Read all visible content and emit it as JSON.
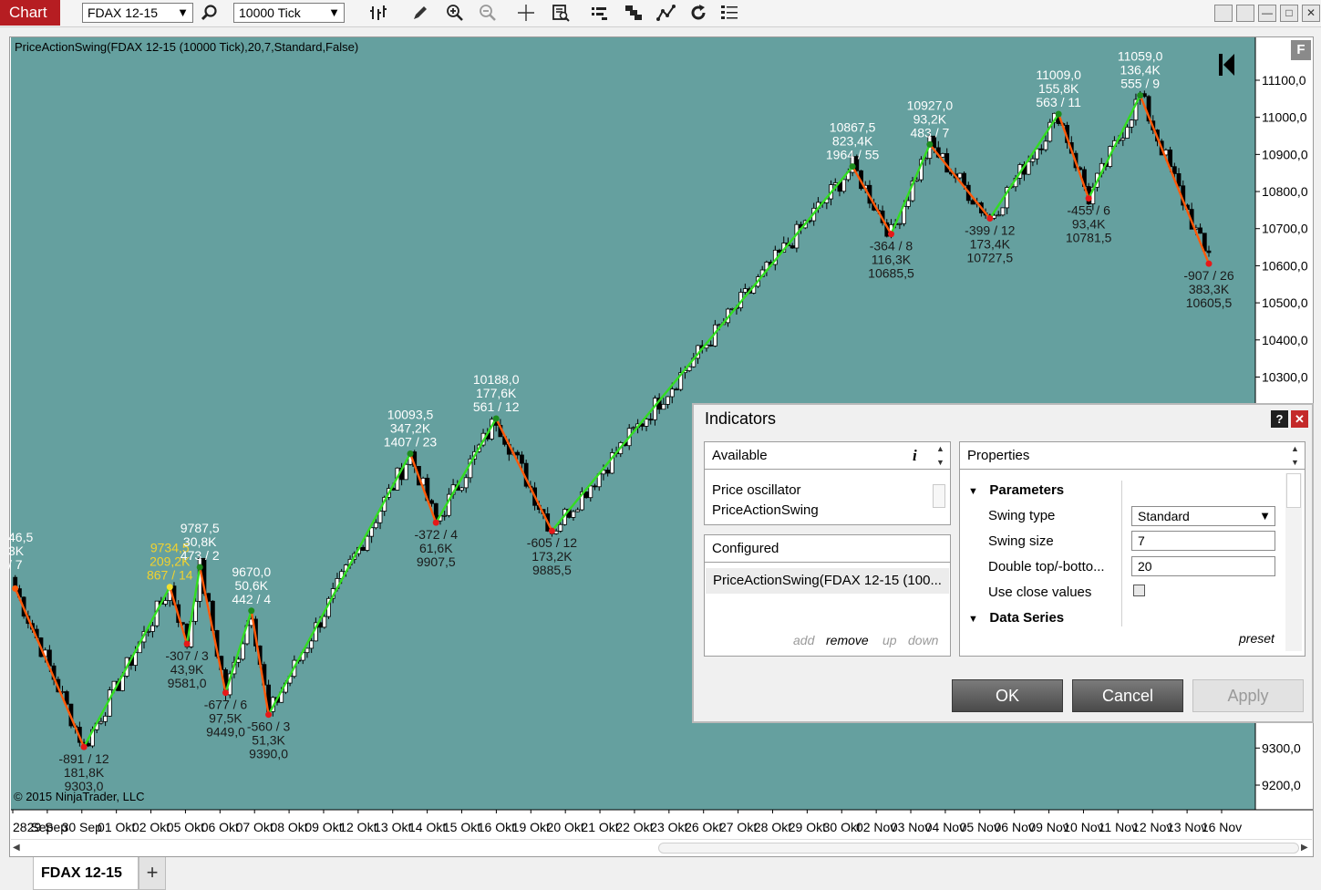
{
  "toolbar": {
    "chart_tab": "Chart",
    "instrument": "FDAX 12-15",
    "interval": "10000 Tick",
    "icons": [
      "search-icon",
      "bar-type-icon",
      "pencil-icon",
      "zoom-in-icon",
      "zoom-out-icon",
      "crosshair-icon",
      "data-box-icon",
      "strategy-icon",
      "chart-trader-icon",
      "indicator-icon",
      "refresh-icon",
      "properties-icon"
    ],
    "window_icons": [
      "minimize-icon",
      "restore-icon",
      "maximize-icon",
      "close-icon"
    ]
  },
  "chart": {
    "title": "PriceActionSwing(FDAX 12-15 (10000 Tick),20,7,Standard,False)",
    "copyright": "© 2015 NinjaTrader, LLC",
    "right_corner_button": "F",
    "colors": {
      "background": "#65a09f",
      "up_swing": "#33dd22",
      "down_swing": "#ff5a0a",
      "label_text": "#ffffff",
      "warning_label": "#f2d22e"
    }
  },
  "chart_data": {
    "type": "candlestick",
    "title": "PriceActionSwing(FDAX 12-15 (10000 Tick),20,7,Standard,False)",
    "y_ticks": [
      "11100,0",
      "11000,0",
      "10900,0",
      "10800,0",
      "10700,0",
      "10600,0",
      "10500,0",
      "10400,0",
      "10300,0",
      "9300,0",
      "9200,0"
    ],
    "y_tick_values": [
      11100,
      11000,
      10900,
      10800,
      10700,
      10600,
      10500,
      10400,
      10300,
      9300,
      9200
    ],
    "ylim": [
      9130,
      11225
    ],
    "x_ticks": [
      "28 Sep",
      "29 Sep",
      "30 Sep",
      "01 Okt",
      "02 Okt",
      "05 Okt",
      "06 Okt",
      "07 Okt",
      "08 Okt",
      "09 Okt",
      "12 Okt",
      "13 Okt",
      "14 Okt",
      "15 Okt",
      "16 Okt",
      "19 Okt",
      "20 Okt",
      "21 Okt",
      "22 Okt",
      "23 Okt",
      "26 Okt",
      "27 Okt",
      "28 Okt",
      "29 Okt",
      "30 Okt",
      "02 Nov",
      "03 Nov",
      "04 Nov",
      "05 Nov",
      "06 Nov",
      "09 Nov",
      "10 Nov",
      "11 Nov",
      "12 Nov",
      "13 Nov",
      "16 Nov"
    ],
    "bar_count": 280,
    "swing_points": [
      {
        "bar": 1,
        "price": 9730,
        "kind": "high"
      },
      {
        "bar": 17,
        "price": 9303,
        "kind": "low",
        "labels": [
          "-891 / 12",
          "181,8K",
          "9303,0"
        ]
      },
      {
        "bar": 37,
        "price": 9734,
        "kind": "high",
        "warn": true,
        "labels": [
          "9734,5",
          "209,2K",
          "867 / 14"
        ]
      },
      {
        "bar": 41,
        "price": 9581,
        "kind": "low",
        "labels": [
          "-307 / 3",
          "43,9K",
          "9581,0"
        ]
      },
      {
        "bar": 44,
        "price": 9787.5,
        "kind": "high",
        "labels": [
          "9787,5",
          "30,8K",
          "473 / 2"
        ]
      },
      {
        "bar": 50,
        "price": 9449,
        "kind": "low",
        "labels": [
          "-677 / 6",
          "97,5K",
          "9449,0"
        ]
      },
      {
        "bar": 56,
        "price": 9670,
        "kind": "high",
        "labels": [
          "9670,0",
          "50,6K",
          "442 / 4"
        ]
      },
      {
        "bar": 60,
        "price": 9390,
        "kind": "low",
        "labels": [
          "-560 / 3",
          "51,3K",
          "9390,0"
        ]
      },
      {
        "bar": 93,
        "price": 10093.5,
        "kind": "high",
        "labels": [
          "10093,5",
          "347,2K",
          "1407 / 23"
        ]
      },
      {
        "bar": 99,
        "price": 9907.5,
        "kind": "low",
        "labels": [
          "-372 / 4",
          "61,6K",
          "9907,5"
        ]
      },
      {
        "bar": 113,
        "price": 10188,
        "kind": "high",
        "labels": [
          "10188,0",
          "177,6K",
          "561 / 12"
        ]
      },
      {
        "bar": 126,
        "price": 9885.5,
        "kind": "low",
        "labels": [
          "-605 / 12",
          "173,2K",
          "9885,5"
        ]
      },
      {
        "bar": 196,
        "price": 10867.5,
        "kind": "high",
        "labels": [
          "10867,5",
          "823,4K",
          "1964 / 55"
        ]
      },
      {
        "bar": 205,
        "price": 10685.5,
        "kind": "low",
        "labels": [
          "-364 / 8",
          "116,3K",
          "10685,5"
        ]
      },
      {
        "bar": 214,
        "price": 10927,
        "kind": "high",
        "labels": [
          "10927,0",
          "93,2K",
          "483 / 7"
        ]
      },
      {
        "bar": 228,
        "price": 10727.5,
        "kind": "low",
        "labels": [
          "-399 / 12",
          "173,4K",
          "10727,5"
        ]
      },
      {
        "bar": 244,
        "price": 11009,
        "kind": "high",
        "labels": [
          "11009,0",
          "155,8K",
          "563 / 11"
        ]
      },
      {
        "bar": 251,
        "price": 10781.5,
        "kind": "low",
        "labels": [
          "-455 / 6",
          "93,4K",
          "10781,5"
        ]
      },
      {
        "bar": 263,
        "price": 11059,
        "kind": "high",
        "labels": [
          "11059,0",
          "136,4K",
          "555 / 9"
        ]
      },
      {
        "bar": 279,
        "price": 10605.5,
        "kind": "low",
        "labels": [
          "-907 / 26",
          "383,3K",
          "10605,5"
        ]
      }
    ],
    "partial_labels_left": [
      "46,5",
      "3K",
      "/ 7"
    ]
  },
  "indicators_dialog": {
    "title": "Indicators",
    "help_label": "?",
    "close_label": "✕",
    "available": {
      "header": "Available",
      "info": "i",
      "items": [
        "Price oscillator",
        "PriceActionSwing"
      ]
    },
    "configured": {
      "header": "Configured",
      "items": [
        "PriceActionSwing(FDAX 12-15 (100..."
      ],
      "actions": {
        "add": "add",
        "remove": "remove",
        "up": "up",
        "down": "down"
      }
    },
    "properties": {
      "header": "Properties",
      "sections": [
        "Parameters",
        "Data Series"
      ],
      "params": [
        {
          "label": "Swing type",
          "value": "Standard"
        },
        {
          "label": "Swing size",
          "value": "7"
        },
        {
          "label": "Double top/-botto...",
          "value": "20"
        },
        {
          "label": "Use close values",
          "value": ""
        }
      ],
      "preset": "preset"
    },
    "buttons": {
      "ok": "OK",
      "cancel": "Cancel",
      "apply": "Apply"
    }
  },
  "bottom_tabs": {
    "instrument": "FDAX 12-15",
    "add": "+"
  }
}
